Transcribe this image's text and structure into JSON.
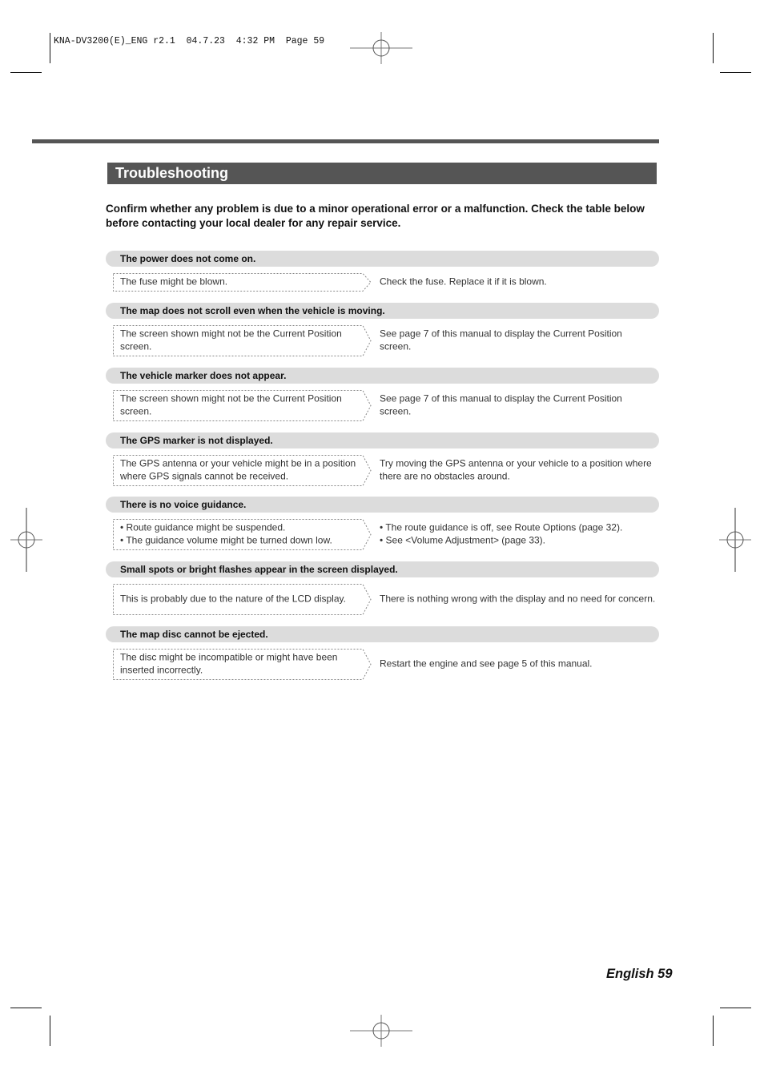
{
  "print_slug": "KNA-DV3200(E)_ENG r2.1  04.7.23  4:32 PM  Page 59",
  "title": "Troubleshooting",
  "intro": "Confirm whether any problem is due to a minor operational error or a malfunction. Check the table below before contacting your local dealer for any repair service.",
  "sections": [
    {
      "problem": "The power does not come on.",
      "cause": [
        "The fuse might be blown."
      ],
      "remedy": [
        "Check the fuse. Replace it if it is blown."
      ]
    },
    {
      "problem": "The map does not scroll even when the vehicle is moving.",
      "cause": [
        "The screen shown might not be the Current Position screen."
      ],
      "remedy": [
        "See page 7 of this manual to display the Current Position screen."
      ]
    },
    {
      "problem": "The vehicle marker does not appear.",
      "cause": [
        "The screen shown might not be the Current Position screen."
      ],
      "remedy": [
        "See page 7 of this manual to display the Current Position screen."
      ]
    },
    {
      "problem": "The GPS marker is not displayed.",
      "cause": [
        "The GPS antenna or your vehicle might be in a position where GPS signals cannot be received."
      ],
      "remedy": [
        "Try moving the GPS antenna or your vehicle to a position where there are no obstacles around."
      ]
    },
    {
      "problem": "There is no voice guidance.",
      "cause": [
        "• Route guidance might be suspended.",
        "• The guidance volume might be turned down low."
      ],
      "remedy": [
        "• The route guidance is off, see Route Options (page 32).",
        "• See <Volume Adjustment> (page 33)."
      ]
    },
    {
      "problem": "Small spots or bright flashes appear in the screen displayed.",
      "cause": [
        "This is probably due to the nature of the LCD display."
      ],
      "remedy": [
        "There is nothing wrong with the display and no need for concern."
      ]
    },
    {
      "problem": "The map disc cannot be ejected.",
      "cause": [
        "The disc might be incompatible or might have been inserted incorrectly."
      ],
      "remedy": [
        "Restart the engine and see page 5 of this manual."
      ]
    }
  ],
  "footer": "English 59"
}
